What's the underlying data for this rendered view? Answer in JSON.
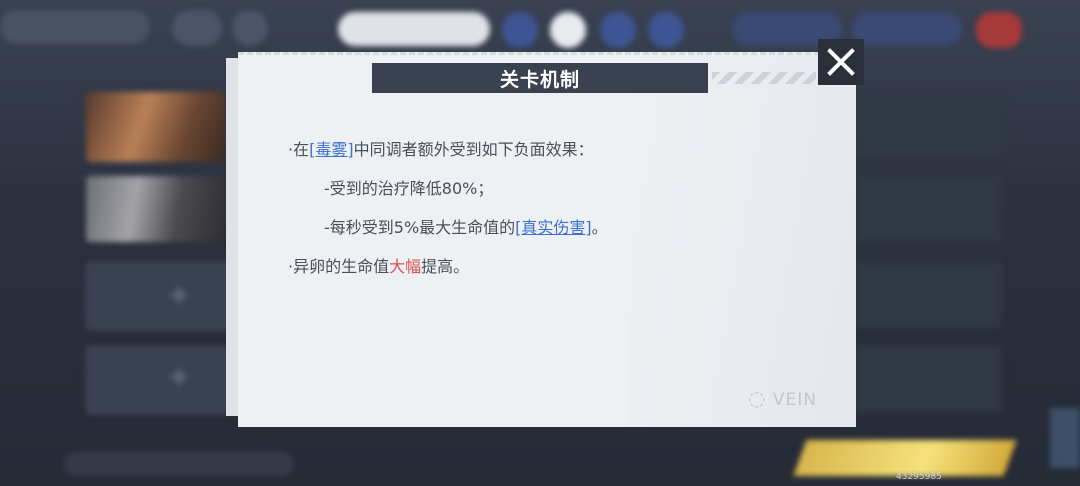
{
  "dialog": {
    "title": "关卡机制",
    "lines": [
      {
        "bullet": "·",
        "prefix": "在",
        "link": "[毒雾]",
        "suffix": "中同调者额外受到如下负面效果："
      },
      {
        "text": "-受到的治疗降低80%；"
      },
      {
        "prefix": "-每秒受到5%最大生命值的",
        "link": "[真实伤害]",
        "suffix": "。"
      },
      {
        "bullet": "·",
        "prefix": "异卵的生命值",
        "highlight": "大幅",
        "suffix": "提高。"
      }
    ],
    "watermark": "VEIN",
    "colors": {
      "link": "#3b6fd0",
      "highlight": "#d9534f",
      "title_bg": "#3a4150"
    }
  },
  "footer": {
    "id": "43295985"
  }
}
